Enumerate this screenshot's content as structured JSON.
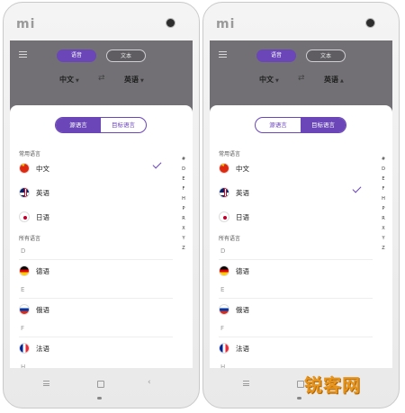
{
  "phones": [
    {
      "device_logo": "mi",
      "tabs": {
        "voice": "语音",
        "text": "文本"
      },
      "source_lang": "中文",
      "target_lang": "英语",
      "segment": {
        "source": "源语言",
        "target": "目标语言",
        "active": "source"
      },
      "common_title": "常用语言",
      "common": [
        {
          "name": "中文",
          "flag": "cn",
          "checked": true
        },
        {
          "name": "英语",
          "flag": "uk",
          "checked": false
        },
        {
          "name": "日语",
          "flag": "jp",
          "checked": false
        }
      ],
      "all_title": "所有语言",
      "all": [
        {
          "letter": "D"
        },
        {
          "name": "德语",
          "flag": "de"
        },
        {
          "letter": "E"
        },
        {
          "name": "俄语",
          "flag": "ru"
        },
        {
          "letter": "F"
        },
        {
          "name": "法语",
          "flag": "fr"
        },
        {
          "letter": "H"
        }
      ]
    },
    {
      "device_logo": "mi",
      "tabs": {
        "voice": "语音",
        "text": "文本"
      },
      "source_lang": "中文",
      "target_lang": "英语",
      "segment": {
        "source": "源语言",
        "target": "目标语言",
        "active": "target"
      },
      "common_title": "常用语言",
      "common": [
        {
          "name": "中文",
          "flag": "cn",
          "checked": false
        },
        {
          "name": "英语",
          "flag": "uk",
          "checked": true
        },
        {
          "name": "日语",
          "flag": "jp",
          "checked": false
        }
      ],
      "all_title": "所有语言",
      "all": [
        {
          "letter": "D"
        },
        {
          "name": "德语",
          "flag": "de"
        },
        {
          "letter": "E"
        },
        {
          "name": "俄语",
          "flag": "ru"
        },
        {
          "letter": "F"
        },
        {
          "name": "法语",
          "flag": "fr"
        },
        {
          "letter": "H"
        }
      ]
    }
  ],
  "index_letters": [
    "#",
    "D",
    "E",
    "F",
    "H",
    "P",
    "R",
    "X",
    "Y",
    "Z"
  ],
  "watermark": "锐客网",
  "colors": {
    "accent": "#6a46b8",
    "overlay": "#727075"
  }
}
